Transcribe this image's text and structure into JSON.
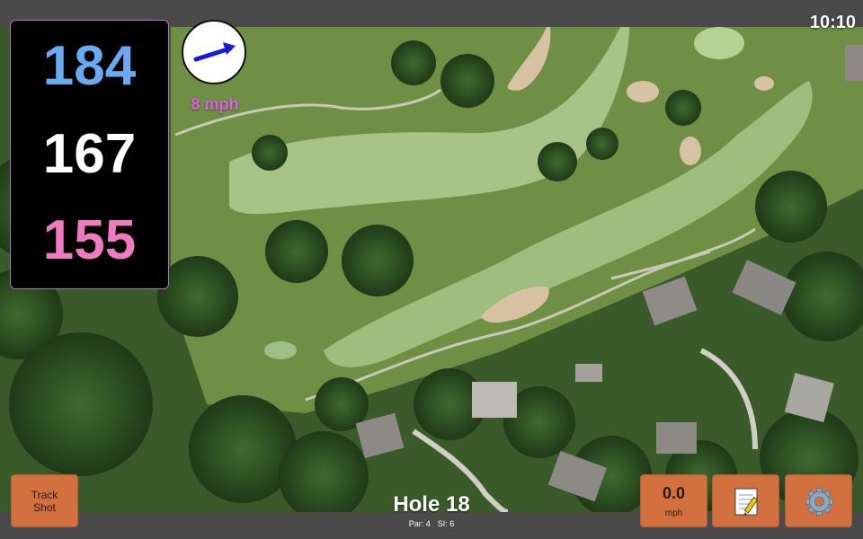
{
  "status": {
    "time": "10:10"
  },
  "distances": {
    "back": "184",
    "middle": "167",
    "front": "155"
  },
  "colors": {
    "back": "#6aaaf2",
    "middle": "#ffffff",
    "front": "#f07ac0",
    "button": "#d2703f",
    "wind_text": "#e060e6",
    "arrow": "#1a1adc"
  },
  "wind": {
    "speed_label": "8 mph",
    "arrow_icon": "wind-direction-arrow-icon"
  },
  "buttons": {
    "track_shot": "Track\nShot",
    "wind_value": "0.0",
    "wind_unit": "mph",
    "notes_icon": "notepad-icon",
    "settings_icon": "gear-icon"
  },
  "hole": {
    "title": "Hole 18",
    "par": "Par: 4",
    "si": "SI: 6"
  },
  "map": {
    "description_icon": "satellite-map"
  }
}
